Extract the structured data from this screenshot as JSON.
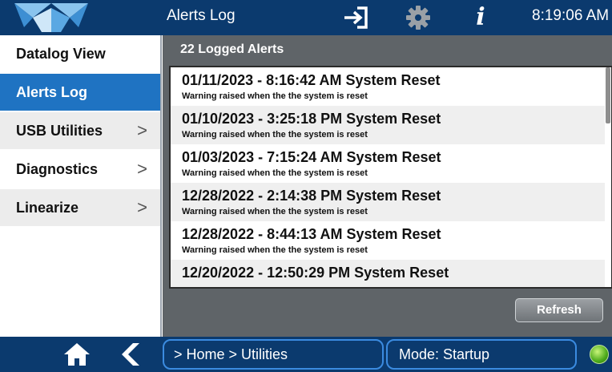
{
  "header": {
    "title": "Alerts Log",
    "time": "8:19:06 AM",
    "info_glyph": "i",
    "icons": [
      "logo-icon",
      "exit-icon",
      "gear-icon",
      "info-icon"
    ],
    "colors": {
      "bar": "#0b3a6e",
      "accent": "#1f73c2"
    }
  },
  "sidebar": {
    "items": [
      {
        "label": "Datalog View",
        "chevron": ""
      },
      {
        "label": "Alerts Log",
        "chevron": ""
      },
      {
        "label": "USB Utilities",
        "chevron": ">"
      },
      {
        "label": "Diagnostics",
        "chevron": ">"
      },
      {
        "label": "Linearize",
        "chevron": ">"
      }
    ],
    "active": "Alerts Log"
  },
  "main": {
    "count_label": "22 Logged Alerts",
    "alerts": [
      {
        "title": "01/11/2023 - 8:16:42 AM System Reset",
        "desc": "Warning raised when the the system is reset"
      },
      {
        "title": "01/10/2023 - 3:25:18 PM System Reset",
        "desc": "Warning raised when the the system is reset"
      },
      {
        "title": "01/03/2023 - 7:15:24 AM System Reset",
        "desc": "Warning raised when the the system is reset"
      },
      {
        "title": "12/28/2022 - 2:14:38 PM System Reset",
        "desc": "Warning raised when the the system is reset"
      },
      {
        "title": "12/28/2022 - 8:44:13 AM System Reset",
        "desc": "Warning raised when the the system is reset"
      },
      {
        "title": "12/20/2022 - 12:50:29 PM System Reset",
        "desc": ""
      }
    ],
    "refresh_label": "Refresh"
  },
  "footer": {
    "breadcrumb": "> Home > Utilities",
    "mode": "Mode: Startup",
    "icons": [
      "home-icon",
      "back-icon",
      "status-globe-icon"
    ],
    "status_color": "#4caa1a"
  }
}
